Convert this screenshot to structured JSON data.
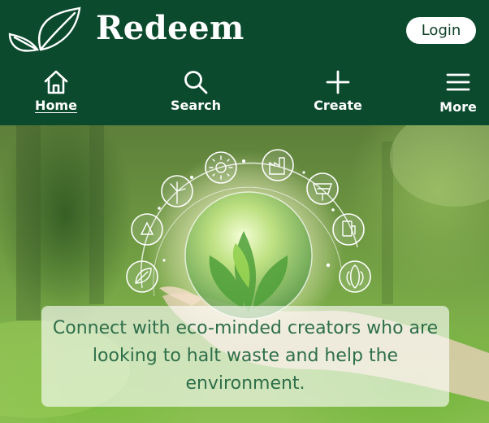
{
  "header": {
    "brand_name": "Redeem",
    "login_label": "Login",
    "logo_icon": "leaves-logo-icon",
    "background": "#0b4a2d"
  },
  "nav": {
    "items": [
      {
        "label": "Home",
        "icon": "home-icon",
        "active": true
      },
      {
        "label": "Search",
        "icon": "search-icon",
        "active": false
      },
      {
        "label": "Create",
        "icon": "plus-icon",
        "active": false
      },
      {
        "label": "More",
        "icon": "menu-icon",
        "active": false
      }
    ]
  },
  "hero": {
    "tagline": "Connect with eco-minded creators who are looking to halt waste and help the environment.",
    "image_icons": [
      "leaf-icon",
      "recycle-icon",
      "wind-turbine-icon",
      "sun-icon",
      "factory-icon",
      "solar-panel-icon",
      "fuel-pump-icon",
      "corn-icon"
    ]
  }
}
